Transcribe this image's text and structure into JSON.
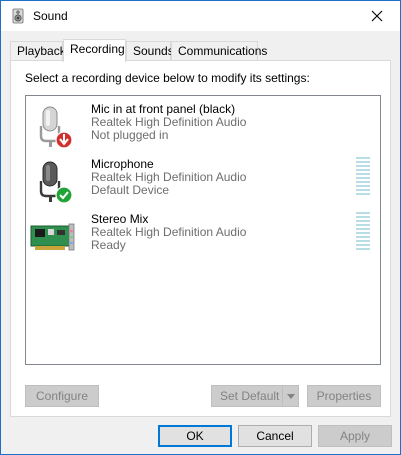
{
  "window": {
    "title": "Sound",
    "app_icon": "speaker-icon",
    "close_icon": "close-icon"
  },
  "tabs": [
    {
      "label": "Playback",
      "active": false
    },
    {
      "label": "Recording",
      "active": true
    },
    {
      "label": "Sounds",
      "active": false
    },
    {
      "label": "Communications",
      "active": false
    }
  ],
  "panel": {
    "instruction": "Select a recording device below to modify its settings:"
  },
  "devices": [
    {
      "name": "Mic in at front panel (black)",
      "driver": "Realtek High Definition Audio",
      "status": "Not plugged in",
      "icon": "microphone-icon",
      "badge": "red-down-arrow-badge",
      "show_meter": false
    },
    {
      "name": "Microphone",
      "driver": "Realtek High Definition Audio",
      "status": "Default Device",
      "icon": "microphone-icon",
      "badge": "green-check-badge",
      "show_meter": true,
      "level": 0
    },
    {
      "name": "Stereo Mix",
      "driver": "Realtek High Definition Audio",
      "status": "Ready",
      "icon": "sound-card-icon",
      "badge": "",
      "show_meter": true,
      "level": 0
    }
  ],
  "panel_buttons": {
    "configure": "Configure",
    "set_default": "Set Default",
    "properties": "Properties"
  },
  "dialog_buttons": {
    "ok": "OK",
    "cancel": "Cancel",
    "apply": "Apply"
  },
  "colors": {
    "accent": "#0078d7",
    "meter_empty": "#b8dde5",
    "disabled_text": "#838383"
  }
}
